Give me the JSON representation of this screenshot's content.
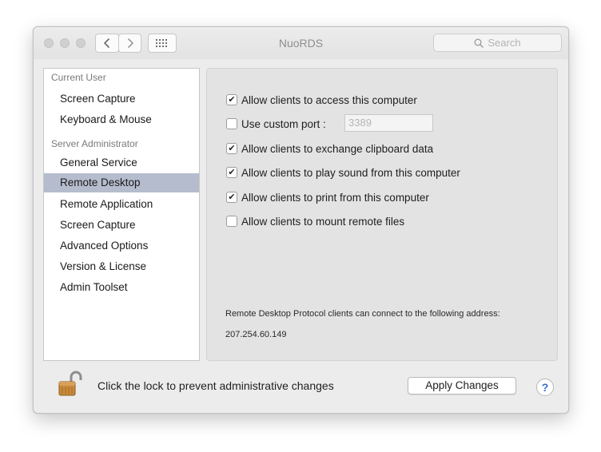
{
  "window": {
    "title": "NuoRDS"
  },
  "search": {
    "placeholder": "Search",
    "icon": "magnifier-icon"
  },
  "sidebar": {
    "sections": [
      {
        "header": "Current User",
        "items": [
          {
            "label": "Screen Capture",
            "selected": false
          },
          {
            "label": "Keyboard & Mouse",
            "selected": false
          }
        ]
      },
      {
        "header": "Server Administrator",
        "items": [
          {
            "label": "General Service",
            "selected": false
          },
          {
            "label": "Remote Desktop",
            "selected": true
          },
          {
            "label": "Remote Application",
            "selected": false
          },
          {
            "label": "Screen Capture",
            "selected": false
          },
          {
            "label": "Advanced Options",
            "selected": false
          },
          {
            "label": "Version & License",
            "selected": false
          },
          {
            "label": "Admin Toolset",
            "selected": false
          }
        ]
      }
    ]
  },
  "options": [
    {
      "label": "Allow clients to access this computer",
      "checked": true
    },
    {
      "label": "Use custom port :",
      "checked": false
    },
    {
      "label": "Allow clients to exchange clipboard data",
      "checked": true
    },
    {
      "label": "Allow clients to play sound from this computer",
      "checked": true
    },
    {
      "label": "Allow clients to print from this computer",
      "checked": true
    },
    {
      "label": "Allow clients to mount remote files",
      "checked": false
    }
  ],
  "port": {
    "placeholder": "3389"
  },
  "info": {
    "address_label": "Remote Desktop Protocol clients can connect to the following address:",
    "address": "207.254.60.149"
  },
  "footer": {
    "lock_text": "Click the lock to prevent administrative changes",
    "apply_label": "Apply Changes",
    "help_label": "?"
  },
  "colors": {
    "selection": "#b5bccd",
    "help_accent": "#3a6fd1",
    "lock_body": "#c98a3a"
  }
}
